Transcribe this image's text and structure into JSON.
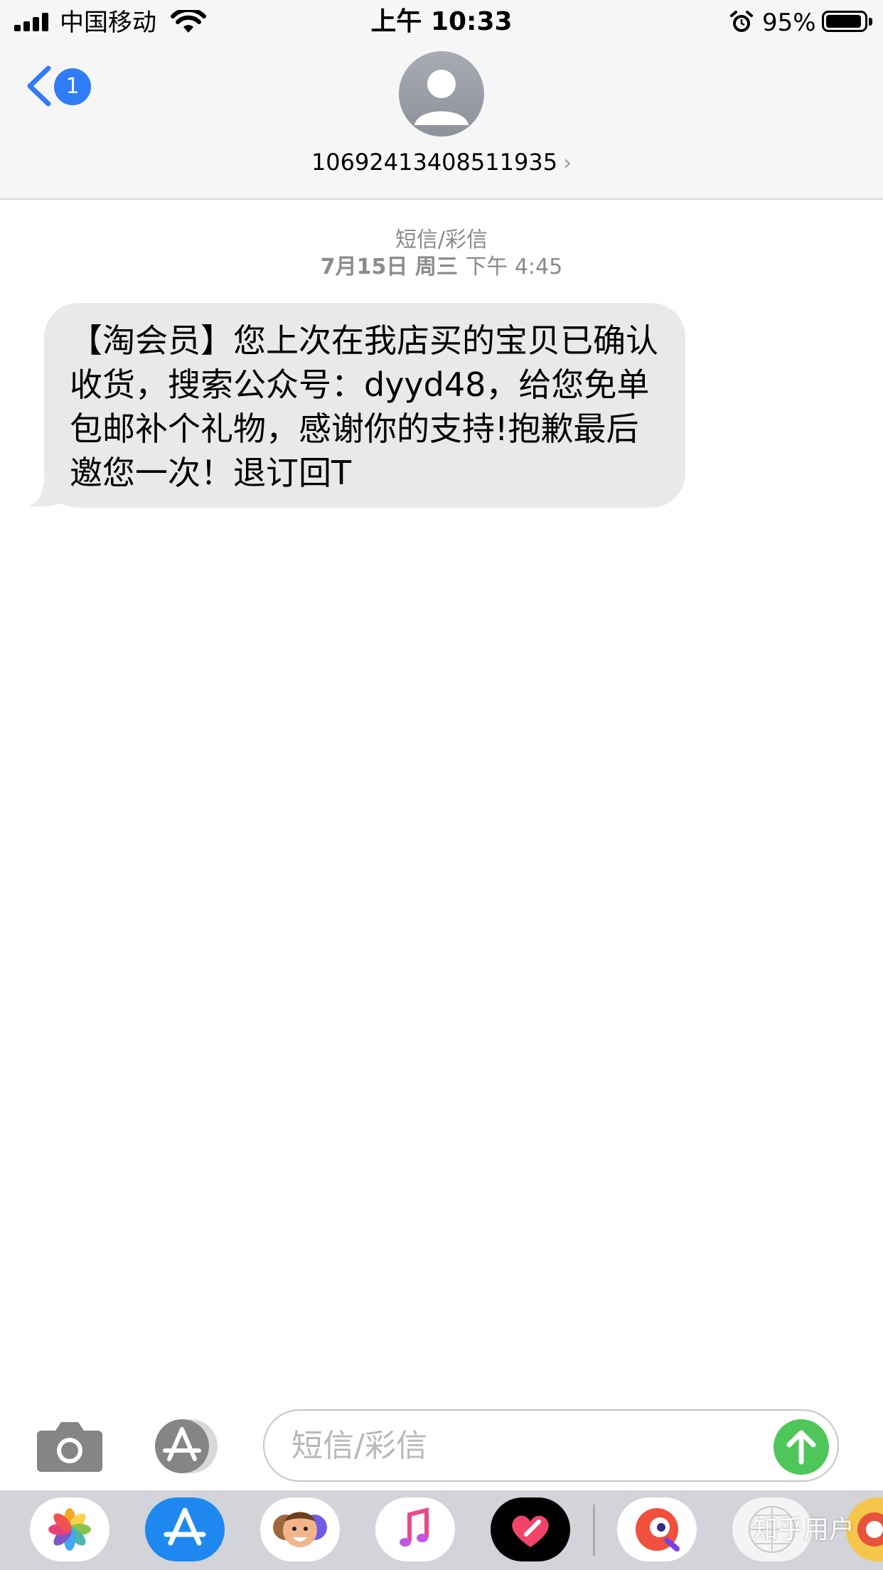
{
  "status_bar": {
    "carrier": "中国移动",
    "time": "上午 10:33",
    "battery_percent": "95%",
    "battery_level": 0.95,
    "icons": [
      "signal-icon",
      "wifi-icon",
      "alarm-icon",
      "battery-icon"
    ]
  },
  "nav": {
    "back_icon": "chevron-left-icon",
    "unread_count": "1",
    "contact_avatar_icon": "person-icon",
    "contact_number": "10692413408511935",
    "contact_chevron": "›",
    "accent_color": "#2f7cf6"
  },
  "conversation": {
    "service_label": "短信/彩信",
    "date": "7月15日 周三",
    "time": "下午 4:45",
    "messages": [
      {
        "direction": "incoming",
        "text": "【淘会员】您上次在我店买的宝贝已确认收货，搜索公众号：dyyd48，给您免单包邮补个礼物，感谢你的支持!抱歉最后邀您一次！退订回T"
      }
    ]
  },
  "compose": {
    "camera_icon": "camera-icon",
    "apps_icon": "app-store-icon",
    "placeholder": "短信/彩信",
    "send_icon": "arrow-up-icon",
    "send_color": "#4ec659"
  },
  "app_drawer": {
    "apps": [
      "photos-icon",
      "app-store-icon",
      "memoji-icon",
      "music-icon",
      "digital-touch-icon",
      "app-icon",
      "app-icon",
      "app-icon"
    ],
    "watermark": "知乎用户"
  }
}
